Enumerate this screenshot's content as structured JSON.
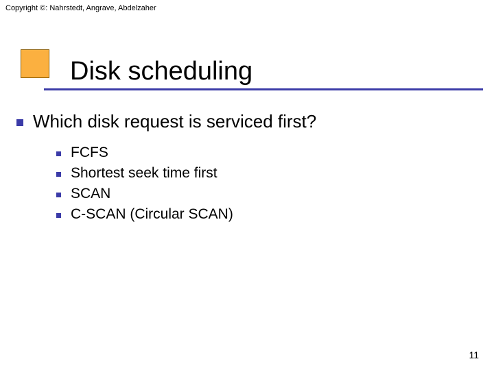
{
  "copyright": "Copyright ©: Nahrstedt, Angrave, Abdelzaher",
  "title": "Disk scheduling",
  "question": "Which disk request is serviced first?",
  "items": {
    "i0": "FCFS",
    "i1": "Shortest seek time first",
    "i2": "SCAN",
    "i3": "C-SCAN (Circular SCAN)"
  },
  "page_number": "11"
}
